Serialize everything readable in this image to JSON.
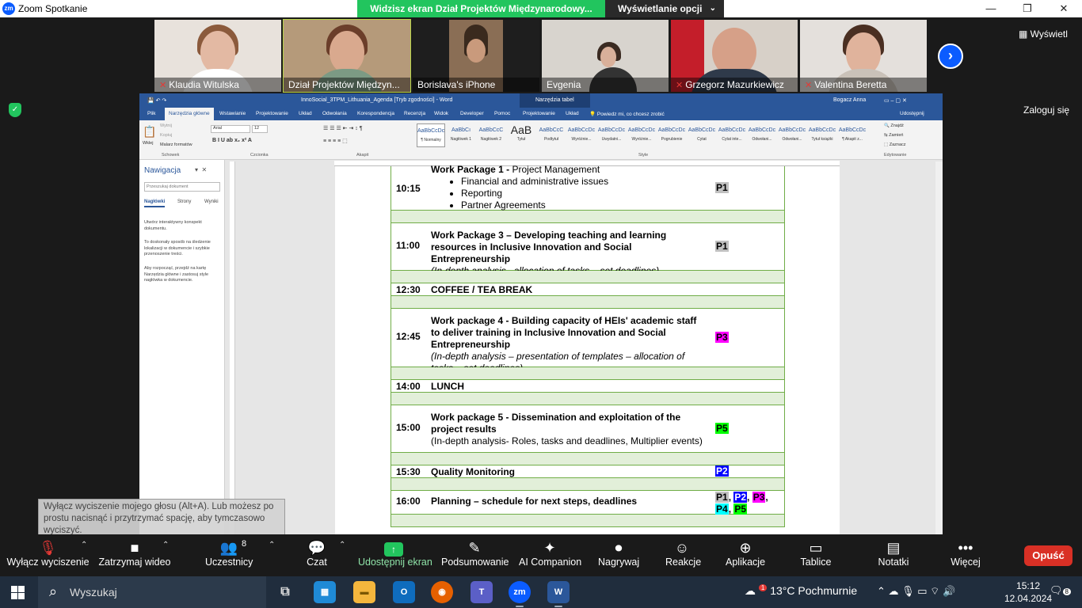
{
  "window": {
    "title": "Zoom Spotkanie",
    "logo": "zm"
  },
  "banner": {
    "sharing": "Widzisz ekran Dział Projektów Międzynarodowy...",
    "view_options": "Wyświetlanie opcji"
  },
  "participants": [
    {
      "name": "Klaudia Witulska",
      "muted": true
    },
    {
      "name": "Dział Projektów Międzyn...",
      "muted": false
    },
    {
      "name": "Borislava's iPhone",
      "muted": false
    },
    {
      "name": "Evgenia",
      "muted": false
    },
    {
      "name": "Grzegorz Mazurkiewicz",
      "muted": true
    },
    {
      "name": "Valentina Beretta",
      "muted": true
    }
  ],
  "view_button": "Wyświetl",
  "signin": "Zaloguj się",
  "word": {
    "doc_title": "InnoSocial_3TPM_Lithuania_Agenda [Tryb zgodności] - Word",
    "context_tab": "Narzędzia tabel",
    "user": "Bogacz Anna",
    "share": "Udostępnij",
    "tabs": [
      "Plik",
      "Narzędzia główne",
      "Wstawianie",
      "Projektowanie",
      "Układ",
      "Odwołania",
      "Korespondencja",
      "Recenzja",
      "Widok",
      "Developer",
      "Pomoc",
      "Projektowanie",
      "Układ"
    ],
    "tell_me": "Powiedz mi, co chcesz zrobić",
    "ribbon": {
      "clipboard": {
        "paste": "Wklej",
        "cut": "Wytnij",
        "copy": "Kopiuj",
        "painter": "Malarz formatów",
        "label": "Schowek"
      },
      "font": {
        "name": "Arial",
        "size": "12",
        "label": "Czcionka"
      },
      "paragraph_label": "Akapit",
      "styles_label": "Style",
      "editing": {
        "find": "Znajdź",
        "replace": "Zamień",
        "select": "Zaznacz",
        "label": "Edytowanie"
      },
      "styles": [
        {
          "preview": "AaBbCcDc",
          "name": "¶ Normalny"
        },
        {
          "preview": "AaBbCı",
          "name": "Nagłówek 1"
        },
        {
          "preview": "AaBbCcC",
          "name": "Nagłówek 2"
        },
        {
          "preview": "AaB",
          "name": "Tytuł"
        },
        {
          "preview": "AaBbCcC",
          "name": "Podtytuł"
        },
        {
          "preview": "AaBbCcDc",
          "name": "Wyróżnie..."
        },
        {
          "preview": "AaBbCcDc",
          "name": "Uwydatni..."
        },
        {
          "preview": "AaBbCcDc",
          "name": "Wyróżnie..."
        },
        {
          "preview": "AaBbCcDc",
          "name": "Pogrubienie"
        },
        {
          "preview": "AaBbCcDc",
          "name": "Cytat"
        },
        {
          "preview": "AaBbCcDc",
          "name": "Cytat inte..."
        },
        {
          "preview": "AaBbCcDc",
          "name": "Odwołani..."
        },
        {
          "preview": "AaBbCcDc",
          "name": "Odwołani..."
        },
        {
          "preview": "AaBbCcDc",
          "name": "Tytuł książki"
        },
        {
          "preview": "AaBbCcDc",
          "name": "¶ Akapit z..."
        }
      ]
    },
    "nav": {
      "title": "Nawigacja",
      "search_placeholder": "Przeszukaj dokument",
      "tabs": [
        "Nagłówki",
        "Strony",
        "Wyniki"
      ],
      "tip1": "Utwórz interaktywny konspekt dokumentu.",
      "tip2": "To doskonały sposób na śledzenie lokalizacji w dokumencie i szybkie przenoszenie treści.",
      "tip3": "Aby rozpocząć, przejdź na kartę Narzędzia główne i zastosuj style nagłówka w dokumencie."
    }
  },
  "agenda": [
    {
      "time": "10:15",
      "title_bold": "Work Package 1 - ",
      "title_rest": "Project Management",
      "bullets": [
        "Financial and administrative issues",
        "Reporting",
        "Partner Agreements"
      ],
      "partners": [
        [
          "P1",
          "gray"
        ]
      ]
    },
    {
      "time": "11:00",
      "title_bold": "Work Package 3 – Developing teaching and learning resources in Inclusive Innovation and Social Entrepreneurship",
      "italic": "(In-depth analysis –allocation of tasks – set deadlines)",
      "partners": [
        [
          "P1",
          "gray"
        ]
      ]
    },
    {
      "time": "12:30",
      "title_bold": "COFFEE / TEA BREAK"
    },
    {
      "time": "12:45",
      "title_bold": "Work package 4 - Building capacity of HEIs' academic staff to deliver training in Inclusive Innovation and Social Entrepreneurship",
      "italic": "(In-depth analysis – presentation of templates – allocation of tasks – set deadlines)",
      "partners": [
        [
          "P3",
          "mag"
        ]
      ]
    },
    {
      "time": "14:00",
      "title_bold": "LUNCH"
    },
    {
      "time": "15:00",
      "title_bold": "Work package 5 - Dissemination and exploitation of the project results",
      "plain": "(In-depth analysis- Roles, tasks and deadlines, Multiplier events)",
      "partners": [
        [
          "P5",
          "green"
        ]
      ]
    },
    {
      "time": "15:30",
      "title_bold": "Quality Monitoring",
      "partners": [
        [
          "P2",
          "blue"
        ]
      ]
    },
    {
      "time": "16:00",
      "title_bold": "Planning – schedule for next steps, deadlines",
      "partners": [
        [
          "P1",
          "gray"
        ],
        [
          "P2",
          "blue"
        ],
        [
          "P3",
          "mag"
        ],
        [
          "P4",
          "cyan"
        ],
        [
          "P5",
          "green"
        ]
      ]
    }
  ],
  "tooltip": "Wyłącz wyciszenie mojego głosu (Alt+A). Lub możesz po prostu nacisnąć i przytrzymać spację, aby tymczasowo wyciszyć.",
  "toolbar": {
    "mute": "Wyłącz wyciszenie",
    "video": "Zatrzymaj wideo",
    "participants": "Uczestnicy",
    "participants_count": "8",
    "chat": "Czat",
    "share": "Udostępnij ekran",
    "summary": "Podsumowanie",
    "ai": "AI Companion",
    "record": "Nagrywaj",
    "reactions": "Reakcje",
    "apps": "Aplikacje",
    "whiteboards": "Tablice",
    "notes": "Notatki",
    "more": "Więcej",
    "leave": "Opuść"
  },
  "taskbar": {
    "search": "Wyszukaj",
    "weather_temp": "13°C",
    "weather_desc": "Pochmurnie",
    "weather_badge": "1",
    "time": "15:12",
    "date": "12.04.2024",
    "notif_count": "8"
  },
  "colors": {
    "zoom_blue": "#0b5cff",
    "share_green": "#22c55e",
    "word_blue": "#2b579a",
    "leave_red": "#d93025",
    "table_green": "#e2efd9"
  }
}
